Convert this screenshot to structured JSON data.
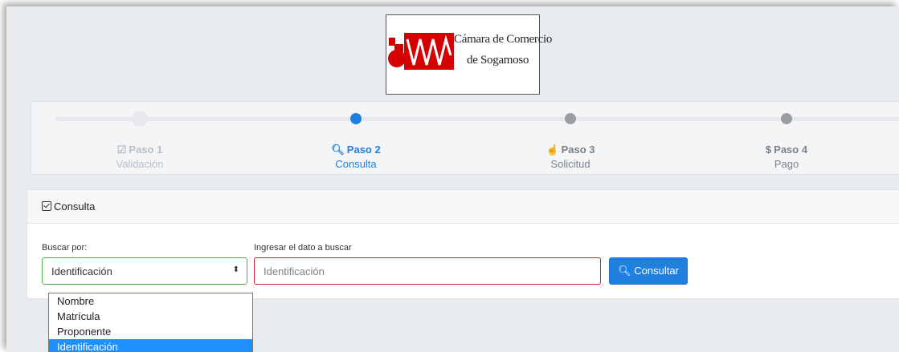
{
  "logo": {
    "line1": "Cámara de Comercio",
    "line2": "de Sogamoso"
  },
  "steps": [
    {
      "title": "Paso 1",
      "subtitle": "Validación",
      "icon": "check-square-icon"
    },
    {
      "title": "Paso 2",
      "subtitle": "Consulta",
      "icon": "search-icon"
    },
    {
      "title": "Paso 3",
      "subtitle": "Solicitud",
      "icon": "hand-pointer-icon"
    },
    {
      "title": "Paso 4",
      "subtitle": "Pago",
      "icon": "dollar-icon"
    }
  ],
  "card": {
    "title": "Consulta"
  },
  "form": {
    "search_by_label": "Buscar por:",
    "search_by_value": "Identificación",
    "options": [
      "Nombre",
      "Matrícula",
      "Proponente",
      "Identificación"
    ],
    "input_label": "Ingresar el dato a buscar",
    "input_placeholder": "Identificación",
    "input_value": "",
    "submit_label": "Consultar"
  },
  "colors": {
    "accent": "#1f80e0",
    "error_border": "#c82333",
    "valid_border": "#4caf50",
    "dropdown_highlight": "#1e90ff"
  }
}
